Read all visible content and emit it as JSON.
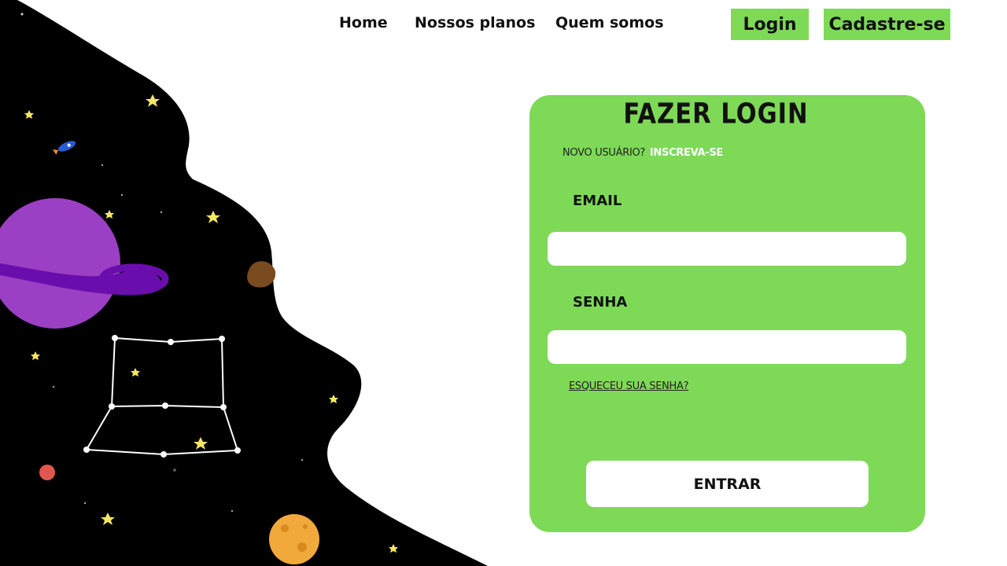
{
  "nav": {
    "home": "Home",
    "plans": "Nossos planos",
    "about": "Quem somos",
    "login": "Login",
    "signup": "Cadastre-se"
  },
  "form": {
    "title": "FAZER LOGIN",
    "new_user_text": "NOVO USUÁRIO?",
    "signup_link": "INSCREVA-SE",
    "email_label": "EMAIL",
    "email_value": "",
    "password_label": "SENHA",
    "password_value": "",
    "forgot_link": "ESQUECEU SUA SENHA?",
    "submit_label": "ENTRAR"
  },
  "colors": {
    "accent": "#7ed957",
    "space": "#000000",
    "planet": "#9b3fc4",
    "ring": "#6a0dad"
  },
  "icons": [
    "rocket-icon",
    "planet-illustration",
    "asteroid-illustration",
    "constellation-illustration",
    "moon-illustration"
  ]
}
